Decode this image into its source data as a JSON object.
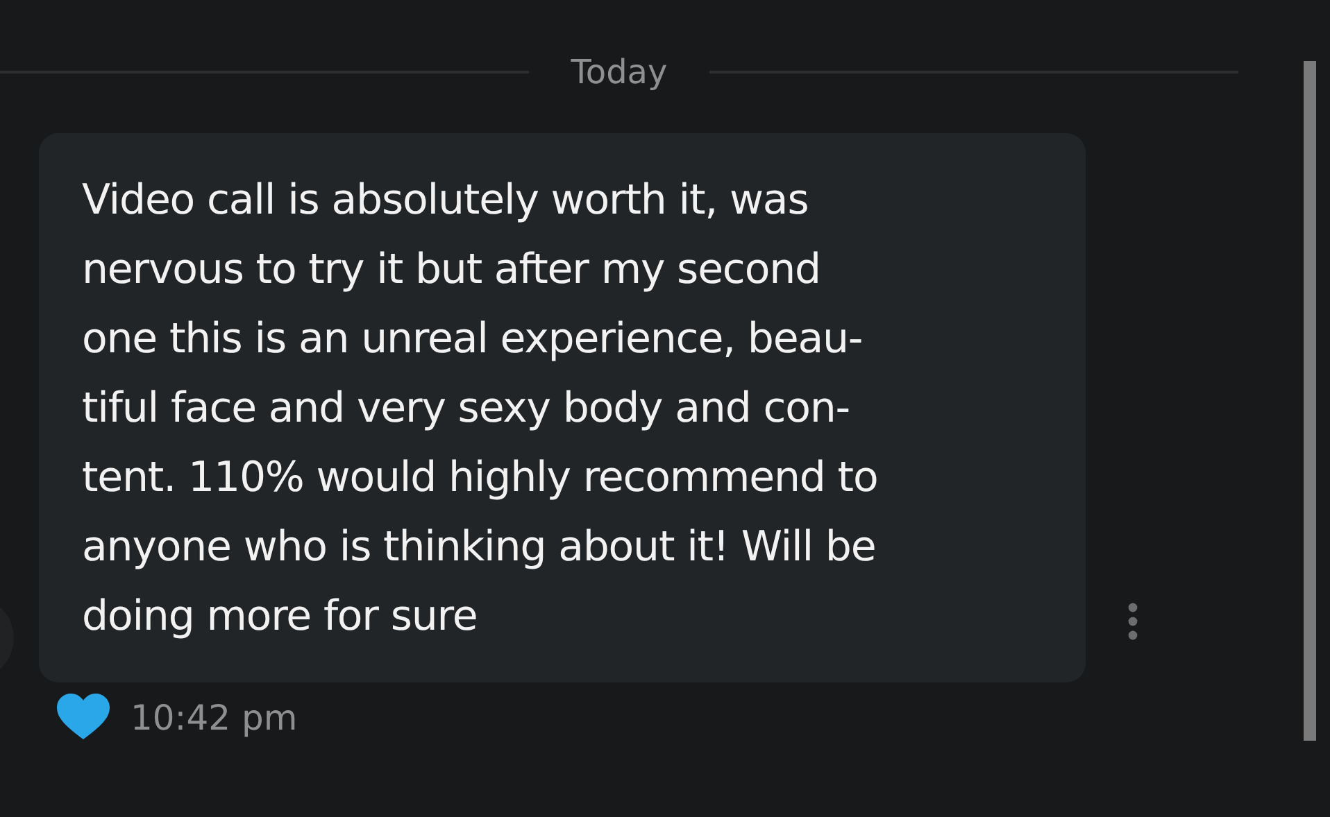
{
  "divider": {
    "label": "Today"
  },
  "message": {
    "lines": [
      "Video call is absolutely worth it, was",
      "nervous to try it but after my second",
      "one this is an unreal experience, beau-",
      "tiful face and very sexy body and con-",
      "tent. 110% would highly recommend to",
      "anyone who is thinking about it! Will be",
      "doing more for sure"
    ],
    "liked": true,
    "time": "10:42 pm"
  }
}
